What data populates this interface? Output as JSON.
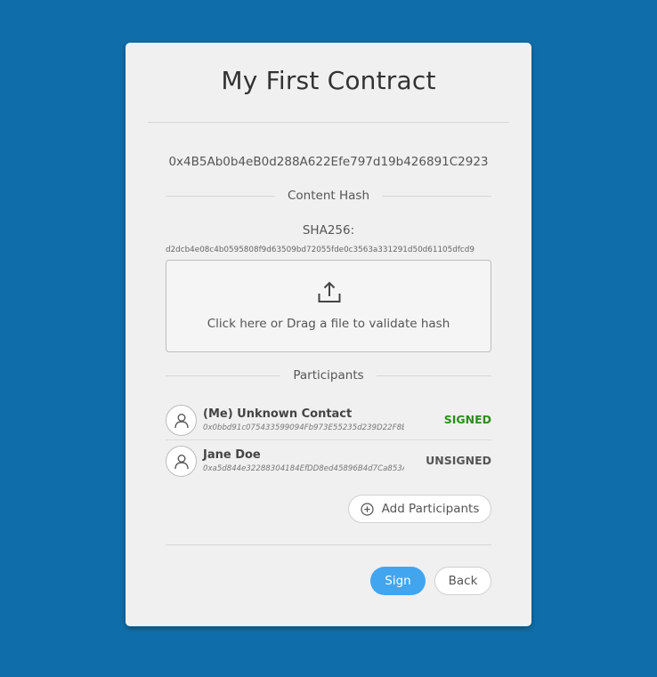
{
  "contract": {
    "title": "My First Contract",
    "address": "0x4B5Ab0b4eB0d288A622Efe797d19b426891C2923"
  },
  "content_hash": {
    "section_label": "Content Hash",
    "algorithm_label": "SHA256:",
    "value": "d2dcb4e08c4b0595808f9d63509bd72055fde0c3563a331291d50d61105dfcd9",
    "dropzone_text": "Click here or Drag a file to validate hash",
    "icon": "upload-icon"
  },
  "participants": {
    "section_label": "Participants",
    "items": [
      {
        "name": "(Me) Unknown Contact",
        "address": "0x0bbd91c075433599094Fb973E55235d239D22F8B",
        "status": "SIGNED",
        "status_color": "#2e8b1e",
        "icon": "user-icon"
      },
      {
        "name": "Jane Doe",
        "address": "0xa5d844e32288304184EfDD8ed45896B4d7Ca853A",
        "status": "UNSIGNED",
        "status_color": "#555555",
        "icon": "user-icon"
      }
    ],
    "add_label": "Add Participants",
    "add_icon": "plus-circle-icon"
  },
  "actions": {
    "sign_label": "Sign",
    "back_label": "Back",
    "accent": "#42a5f0"
  },
  "background_color": "#0f6ea9"
}
